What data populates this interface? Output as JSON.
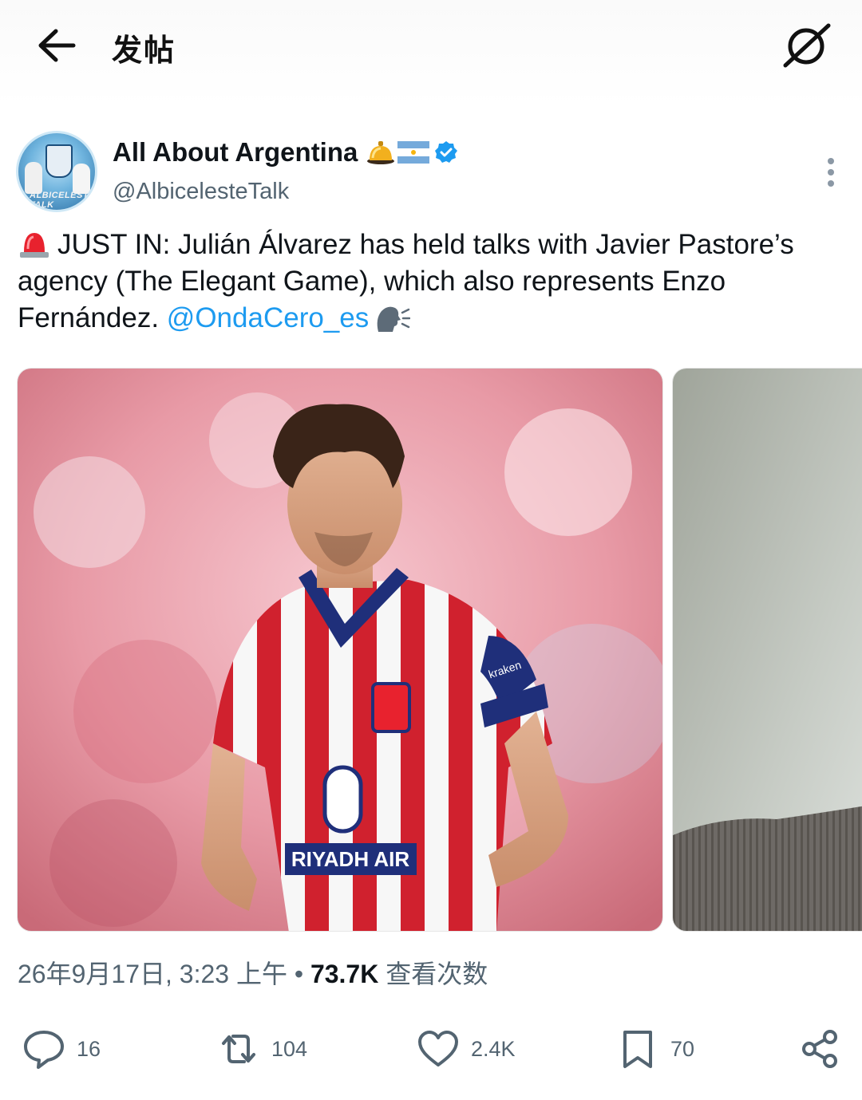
{
  "header": {
    "title": "发帖",
    "back_icon": "arrow-left-icon",
    "grok_icon": "grok-icon"
  },
  "post": {
    "author_name": "All About Argentina",
    "author_handle": "@AlbicelesteTalk",
    "avatar_caption": "ALBICELESTE TALK",
    "text_main": "JUST IN: Julián Álvarez has held talks with Javier Pastore’s agency (The Elegant Game), which also represents Enzo Fernández.",
    "mention": "@OndaCero_es",
    "badges": [
      "bell-emoji",
      "argentina-flag-emoji",
      "verified-badge-icon"
    ],
    "images": [
      {
        "jersey_sponsor": "RIYADH AIR",
        "sleeve_sponsor": "kraken"
      },
      {}
    ],
    "timestamp": "26年9月17日, 3:23 上午",
    "separator": " • ",
    "views_count": "73.7K",
    "views_label": "查看次数"
  },
  "actions": {
    "reply_count": "16",
    "repost_count": "104",
    "like_count": "2.4K",
    "bookmark_count": "70"
  },
  "colors": {
    "link": "#1d9bf0",
    "secondary_text": "#536471",
    "primary_text": "#0f1419"
  }
}
